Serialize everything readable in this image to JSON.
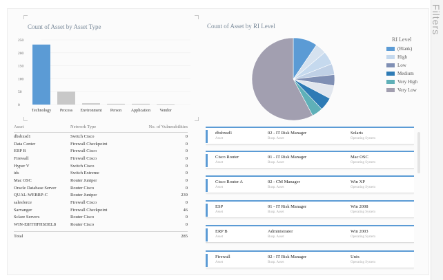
{
  "filters_label": "Filters",
  "bar_chart": {
    "title": "Count of Asset by Asset Type",
    "chart_data": {
      "type": "bar",
      "title": "Count of Asset by Asset Type",
      "categories": [
        "Technology",
        "Process",
        "Environment",
        "Person",
        "Application",
        "Vendor"
      ],
      "values": [
        232,
        50,
        5,
        3,
        3,
        2
      ],
      "ylim": [
        0,
        250
      ],
      "yticks": [
        "250",
        "200",
        "150",
        "100",
        "50",
        "0"
      ],
      "colors": [
        "#5b9bd5",
        "#c8c8c8",
        "#c8c8c8",
        "#c8c8c8",
        "#c8c8c8",
        "#c8c8c8"
      ]
    }
  },
  "pie_chart": {
    "title": "Count of Asset by RI Level",
    "legend_title": "RI Level",
    "chart_data": {
      "type": "pie",
      "title": "Count of Asset by RI Level",
      "series": [
        {
          "name": "(Blank)",
          "value": 11,
          "color": "#5b9bd5"
        },
        {
          "name": "High",
          "value": 6,
          "color": "#c5d9ee"
        },
        {
          "name": "Low",
          "value": 5,
          "color": "#7f8fb4"
        },
        {
          "name": "Medium",
          "value": 6,
          "color": "#2e7bb5"
        },
        {
          "name": "Very High",
          "value": 5,
          "color": "#5fb0b8"
        },
        {
          "name": "Very Low",
          "value": 67,
          "color": "#a29fb0"
        }
      ],
      "extra_slices": [
        {
          "value": 5,
          "color": "#d6e2ef"
        },
        {
          "value": 5,
          "color": "#bfd0e6"
        },
        {
          "value": 6,
          "color": "#e1e6ee"
        }
      ]
    }
  },
  "asset_table": {
    "headers": [
      "Asset",
      "Network Type",
      "No. of Vulnerabilities"
    ],
    "rows": [
      [
        "dbsbxsd1",
        "Switch Cisco",
        "0"
      ],
      [
        "Data Center",
        "Firewall Checkpoint",
        "0"
      ],
      [
        "ERP B",
        "Firewall Cisco",
        "0"
      ],
      [
        "Firewall",
        "Firewall Cisco",
        "0"
      ],
      [
        "Hyper V",
        "Switch Cisco",
        "0"
      ],
      [
        "ids",
        "Switch Extreme",
        "0"
      ],
      [
        "Mac OSC",
        "Router Juniper",
        "0"
      ],
      [
        "Oracle Database Server",
        "Router Cisco",
        "0"
      ],
      [
        "QUAL-WEBRP-C",
        "Router Juniper",
        "239"
      ],
      [
        "salesforce",
        "Firewall Cisco",
        "0"
      ],
      [
        "Sarvanger",
        "Firewall Checkpoint",
        "46"
      ],
      [
        "Sclare Servers",
        "Router Cisco",
        "0"
      ],
      [
        "WIN-E8ITHFHSDEL8",
        "Router Cisco",
        "0"
      ]
    ],
    "total_label": "Total",
    "total_value": "285"
  },
  "asset_cards": [
    {
      "asset": "dbsbxsd1",
      "asset_label": "Asset",
      "manager": "02 - IT Risk Manager",
      "manager_label": "Busp. Asset",
      "os": "Solaris",
      "os_label": "Operating System"
    },
    {
      "asset": "Cisco Router",
      "asset_label": "Asset",
      "manager": "01 - IT Risk Manager",
      "manager_label": "Busp. Asset",
      "os": "Mac OSC",
      "os_label": "Operating System"
    },
    {
      "asset": "Cisco Router A",
      "asset_label": "Asset",
      "manager": "02 - CM Manager",
      "manager_label": "Busp. Asset",
      "os": "Win XP",
      "os_label": "Operating System"
    },
    {
      "asset": "ESP",
      "asset_label": "Asset",
      "manager": "01 - IT Risk Manager",
      "manager_label": "Busp. Asset",
      "os": "Win 2008",
      "os_label": "Operating System"
    },
    {
      "asset": "ERP B",
      "asset_label": "Asset",
      "manager": "Administrator",
      "manager_label": "Busp. Asset",
      "os": "Win 2003",
      "os_label": "Operating System"
    },
    {
      "asset": "Firewall",
      "asset_label": "Asset",
      "manager": "02 - IT Risk Manager",
      "manager_label": "Busp. Asset",
      "os": "Unix",
      "os_label": "Operating System"
    }
  ]
}
